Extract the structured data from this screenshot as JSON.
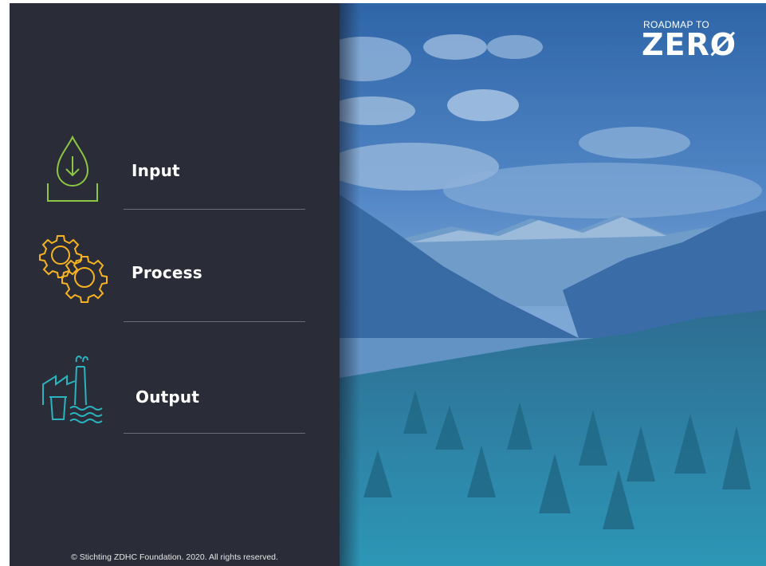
{
  "menu": {
    "items": [
      {
        "label": "Input",
        "icon": "droplet-download-icon",
        "color": "#8dc63f"
      },
      {
        "label": "Process",
        "icon": "gears-icon",
        "color": "#f6b221"
      },
      {
        "label": "Output",
        "icon": "factory-water-icon",
        "color": "#2bb3c0"
      }
    ]
  },
  "footer": {
    "copyright": "© Stichting  ZDHC Foundation.  2020. All  rights  reserved."
  },
  "logo": {
    "top": "ROADMAP TO",
    "main": "ZERØ"
  }
}
